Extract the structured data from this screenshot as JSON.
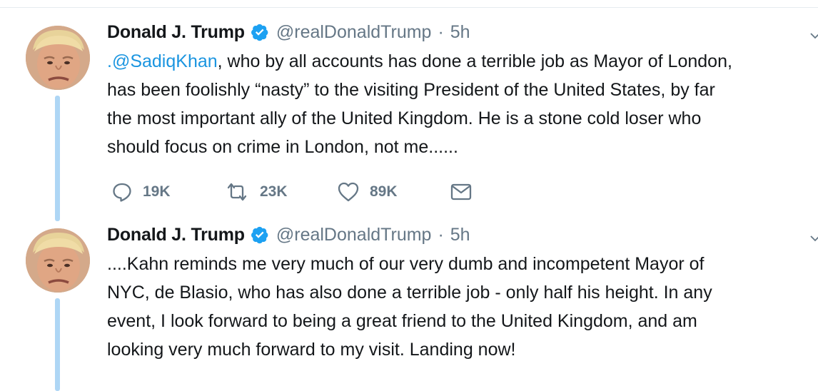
{
  "tweets": [
    {
      "name": "Donald J. Trump",
      "handle": "@realDonaldTrump",
      "separator": "·",
      "time": "5h",
      "mention": ".@SadiqKhan",
      "text_after_mention": ", who by all accounts has done a terrible job as Mayor of London,\nhas been foolishly “nasty” to the visiting President of the United States, by far\nthe most important ally of the United Kingdom. He is a stone cold loser who\nshould focus on crime in London, not me......",
      "replies": "19K",
      "retweets": "23K",
      "likes": "89K",
      "icons": [
        "verified-icon",
        "chevron-down-icon",
        "reply-icon",
        "retweet-icon",
        "like-icon",
        "message-icon"
      ]
    },
    {
      "name": "Donald J. Trump",
      "handle": "@realDonaldTrump",
      "separator": "·",
      "time": "5h",
      "text": "....Kahn reminds me very much of our very dumb and incompetent Mayor of\nNYC, de Blasio, who has also done a terrible job - only half his height. In any\nevent, I look forward to being a great friend to the United Kingdom, and am\nlooking very much forward to my visit. Landing now!",
      "icons": [
        "verified-icon",
        "chevron-down-icon"
      ]
    }
  ],
  "colors": {
    "accent": "#1da1f2",
    "mention": "#1b95e0",
    "thread_line": "#aed6f5",
    "secondary_text": "#657786",
    "primary_text": "#14171a"
  }
}
